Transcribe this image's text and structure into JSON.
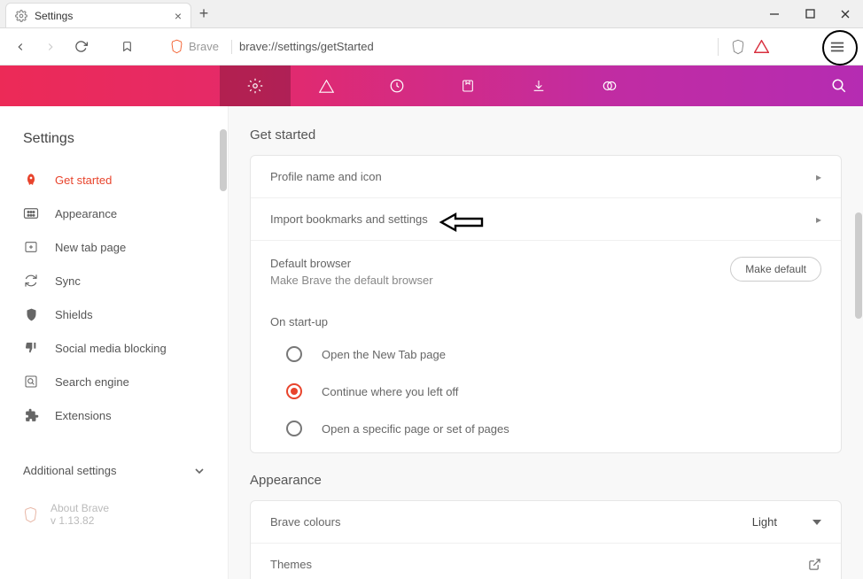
{
  "tab": {
    "title": "Settings"
  },
  "address_bar": {
    "prefix": "Brave",
    "url": "brave://settings/getStarted"
  },
  "sidebar": {
    "heading": "Settings",
    "items": [
      {
        "label": "Get started",
        "icon": "rocket-icon",
        "active": true
      },
      {
        "label": "Appearance",
        "icon": "palette-icon",
        "active": false
      },
      {
        "label": "New tab page",
        "icon": "new-window-icon",
        "active": false
      },
      {
        "label": "Sync",
        "icon": "sync-icon",
        "active": false
      },
      {
        "label": "Shields",
        "icon": "shield-icon",
        "active": false
      },
      {
        "label": "Social media blocking",
        "icon": "thumbs-down-icon",
        "active": false
      },
      {
        "label": "Search engine",
        "icon": "search-square-icon",
        "active": false
      },
      {
        "label": "Extensions",
        "icon": "puzzle-icon",
        "active": false
      }
    ],
    "additional": "Additional settings",
    "about": {
      "title": "About Brave",
      "version": "v 1.13.82"
    }
  },
  "content": {
    "get_started": {
      "title": "Get started",
      "profile_row": "Profile name and icon",
      "import_row": "Import bookmarks and settings",
      "default_browser": {
        "title": "Default browser",
        "sub": "Make Brave the default browser",
        "button": "Make default"
      },
      "startup": {
        "heading": "On start-up",
        "options": [
          {
            "label": "Open the New Tab page",
            "selected": false
          },
          {
            "label": "Continue where you left off",
            "selected": true
          },
          {
            "label": "Open a specific page or set of pages",
            "selected": false
          }
        ]
      }
    },
    "appearance": {
      "title": "Appearance",
      "colours": {
        "label": "Brave colours",
        "value": "Light"
      },
      "themes": {
        "label": "Themes"
      }
    }
  }
}
